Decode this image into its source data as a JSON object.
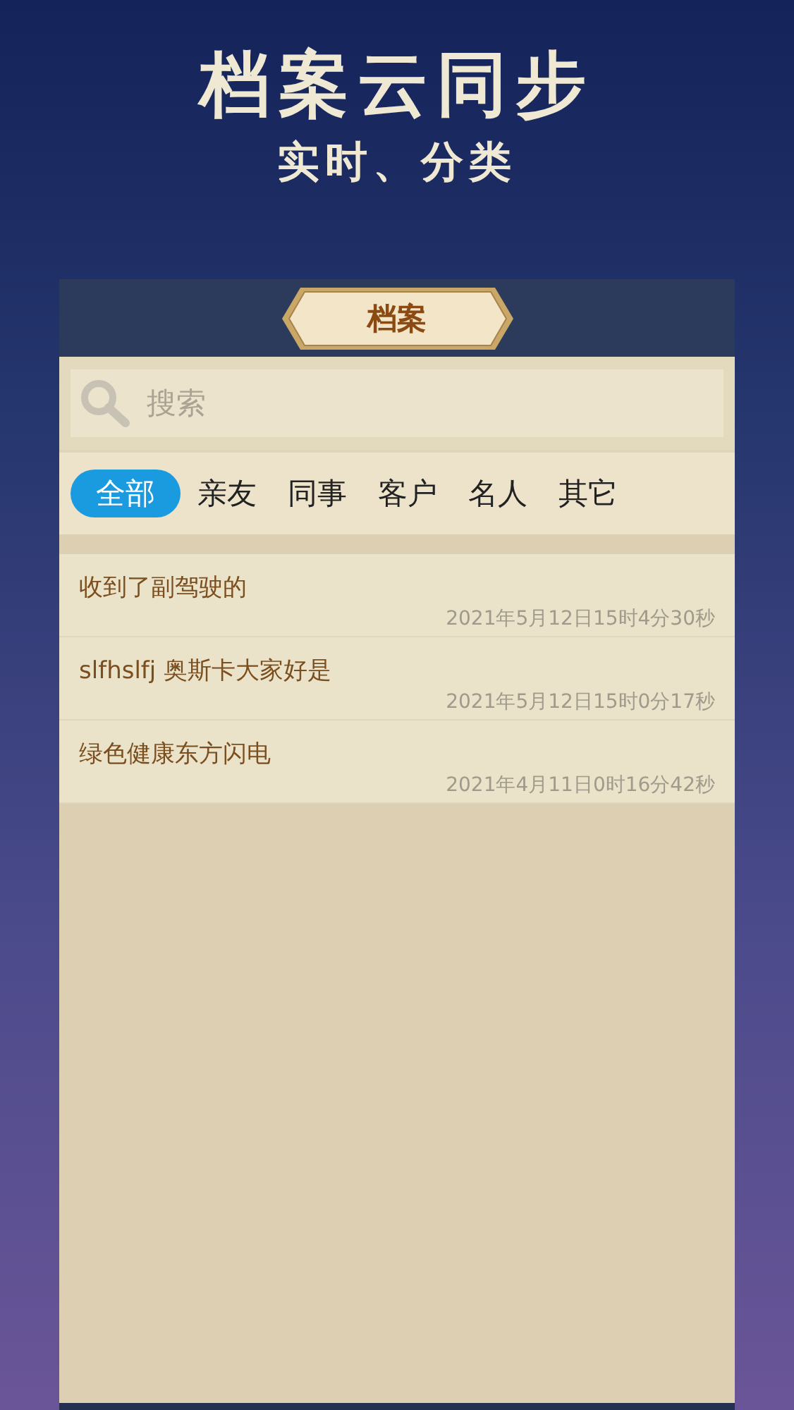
{
  "headline": "档案云同步",
  "subheadline": "实时、分类",
  "screen": {
    "title": "档案",
    "search": {
      "placeholder": "搜索"
    },
    "tabs": [
      {
        "label": "全部",
        "selected": true
      },
      {
        "label": "亲友",
        "selected": false
      },
      {
        "label": "同事",
        "selected": false
      },
      {
        "label": "客户",
        "selected": false
      },
      {
        "label": "名人",
        "selected": false
      },
      {
        "label": "其它",
        "selected": false
      }
    ],
    "records": [
      {
        "title": "收到了副驾驶的",
        "time": "2021年5月12日15时4分30秒"
      },
      {
        "title": "slfhslfj 奥斯卡大家好是",
        "time": "2021年5月12日15时0分17秒"
      },
      {
        "title": "绿色健康东方闪电",
        "time": "2021年4月11日0时16分42秒"
      }
    ]
  }
}
